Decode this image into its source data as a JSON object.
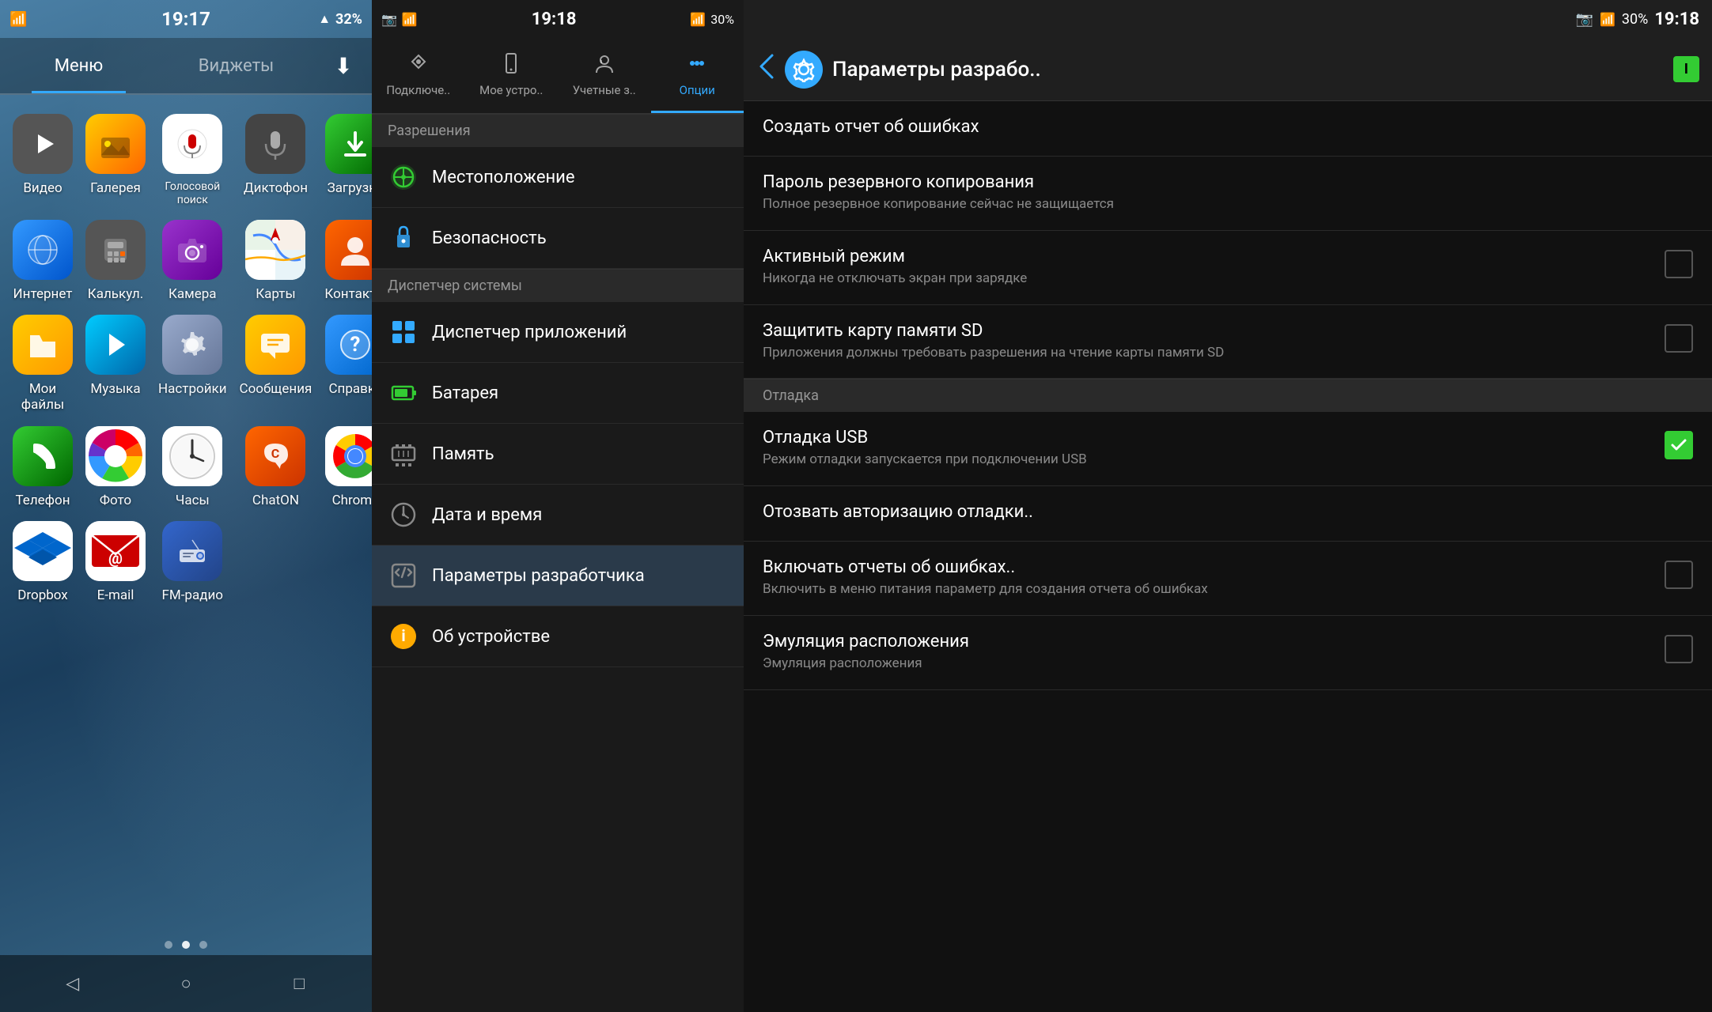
{
  "panel1": {
    "statusBar": {
      "time": "19:17",
      "battery": "32%",
      "signal": "▲",
      "wifi": "wifi"
    },
    "tabs": [
      {
        "label": "Меню",
        "active": true
      },
      {
        "label": "Виджеты",
        "active": false
      }
    ],
    "downloadTabLabel": "⬇",
    "apps": [
      {
        "id": "video",
        "label": "Видео",
        "icon": "▶",
        "colorClass": "icon-video"
      },
      {
        "id": "gallery",
        "label": "Галерея",
        "icon": "🖼",
        "colorClass": "icon-gallery"
      },
      {
        "id": "voice",
        "label": "Голосовой поиск",
        "icon": "🎤",
        "colorClass": "icon-voice"
      },
      {
        "id": "dictaphone",
        "label": "Диктофон",
        "icon": "🎙",
        "colorClass": "icon-dictaphone"
      },
      {
        "id": "download",
        "label": "Загрузки",
        "icon": "⬇",
        "colorClass": "icon-download"
      },
      {
        "id": "internet",
        "label": "Интернет",
        "icon": "🌐",
        "colorClass": "icon-internet"
      },
      {
        "id": "calc",
        "label": "Калькул.",
        "icon": "🔢",
        "colorClass": "icon-calc"
      },
      {
        "id": "camera",
        "label": "Камера",
        "icon": "📷",
        "colorClass": "icon-camera"
      },
      {
        "id": "maps",
        "label": "Карты",
        "icon": "🗺",
        "colorClass": "icon-maps"
      },
      {
        "id": "contacts",
        "label": "Контакты",
        "icon": "👤",
        "colorClass": "icon-contacts"
      },
      {
        "id": "myfiles",
        "label": "Мои файлы",
        "icon": "📁",
        "colorClass": "icon-myfiles"
      },
      {
        "id": "music",
        "label": "Музыка",
        "icon": "▶",
        "colorClass": "icon-music"
      },
      {
        "id": "settings",
        "label": "Настройки",
        "icon": "⚙",
        "colorClass": "icon-settings"
      },
      {
        "id": "messages",
        "label": "Сообщения",
        "icon": "✉",
        "colorClass": "icon-messages"
      },
      {
        "id": "help",
        "label": "Справка",
        "icon": "?",
        "colorClass": "icon-help"
      },
      {
        "id": "phone",
        "label": "Телефон",
        "icon": "📞",
        "colorClass": "icon-phone"
      },
      {
        "id": "photos",
        "label": "Фото",
        "icon": "🌈",
        "colorClass": "icon-photos"
      },
      {
        "id": "clock",
        "label": "Часы",
        "icon": "🕐",
        "colorClass": "icon-clock"
      },
      {
        "id": "chaton",
        "label": "ChatON",
        "icon": "C",
        "colorClass": "icon-chaton"
      },
      {
        "id": "chrome",
        "label": "Chrome",
        "icon": "🔵",
        "colorClass": "icon-chrome"
      },
      {
        "id": "dropbox",
        "label": "Dropbox",
        "icon": "📦",
        "colorClass": "icon-dropbox"
      },
      {
        "id": "email",
        "label": "E-mail",
        "icon": "✉",
        "colorClass": "icon-email"
      },
      {
        "id": "fmradio",
        "label": "FM-радио",
        "icon": "📻",
        "colorClass": "icon-fmradio"
      }
    ],
    "dots": [
      false,
      true,
      false
    ],
    "navButtons": [
      "◁",
      "○",
      "□"
    ]
  },
  "panel2": {
    "statusBar": {
      "time": "19:18",
      "battery": "30%"
    },
    "tabs": [
      {
        "label": "Подключе..",
        "icon": "🔌",
        "active": false
      },
      {
        "label": "Мое устро..",
        "icon": "📱",
        "active": false
      },
      {
        "label": "Учетные з..",
        "icon": "🔑",
        "active": false
      },
      {
        "label": "Опции",
        "icon": "⋯",
        "active": true
      }
    ],
    "sections": [
      {
        "header": "Разрешения",
        "items": [
          {
            "label": "Местоположение",
            "icon": "🎯",
            "iconColor": "#33cc33"
          },
          {
            "label": "Безопасность",
            "icon": "🔒",
            "iconColor": "#33aaff"
          }
        ]
      },
      {
        "header": "Диспетчер системы",
        "items": [
          {
            "label": "Диспетчер приложений",
            "icon": "▦",
            "iconColor": "#33aaff"
          },
          {
            "label": "Батарея",
            "icon": "🔋",
            "iconColor": "#33cc33"
          },
          {
            "label": "Память",
            "icon": "💾",
            "iconColor": "#888"
          },
          {
            "label": "Дата и время",
            "icon": "🕐",
            "iconColor": "#888"
          },
          {
            "label": "Параметры разработчика",
            "icon": "{}",
            "iconColor": "#888"
          },
          {
            "label": "Об устройстве",
            "icon": "ℹ",
            "iconColor": "#ffaa00"
          }
        ]
      }
    ]
  },
  "panel3": {
    "statusBar": {
      "time": "19:18",
      "battery": "30%",
      "batteryColor": "#33cc33"
    },
    "header": {
      "backLabel": "❮",
      "title": "Параметры разрабо..",
      "gearIcon": "⚙"
    },
    "items": [
      {
        "title": "Создать отчет об ошибках",
        "subtitle": "",
        "type": "plain"
      },
      {
        "title": "Пароль резервного копирования",
        "subtitle": "Полное резервное копирование сейчас не защищается",
        "type": "plain"
      },
      {
        "title": "Активный режим",
        "subtitle": "Никогда не отключать экран при зарядке",
        "type": "checkbox",
        "checked": false
      },
      {
        "title": "Защитить карту памяти SD",
        "subtitle": "Приложения должны требовать разрешения на чтение карты памяти SD",
        "type": "checkbox",
        "checked": false
      }
    ],
    "sections": [
      {
        "header": "Отладка",
        "items": [
          {
            "title": "Отладка USB",
            "subtitle": "Режим отладки запускается при подключении USB",
            "type": "checkbox",
            "checked": true
          },
          {
            "title": "Отозвать авторизацию отладки..",
            "subtitle": "",
            "type": "plain"
          },
          {
            "title": "Включать отчеты об ошибках..",
            "subtitle": "Включить в меню питания параметр для создания отчета об ошибках",
            "type": "checkbox",
            "checked": false
          },
          {
            "title": "Эмуляция расположения",
            "subtitle": "Эмуляция расположения",
            "type": "checkbox",
            "checked": false
          }
        ]
      }
    ]
  }
}
